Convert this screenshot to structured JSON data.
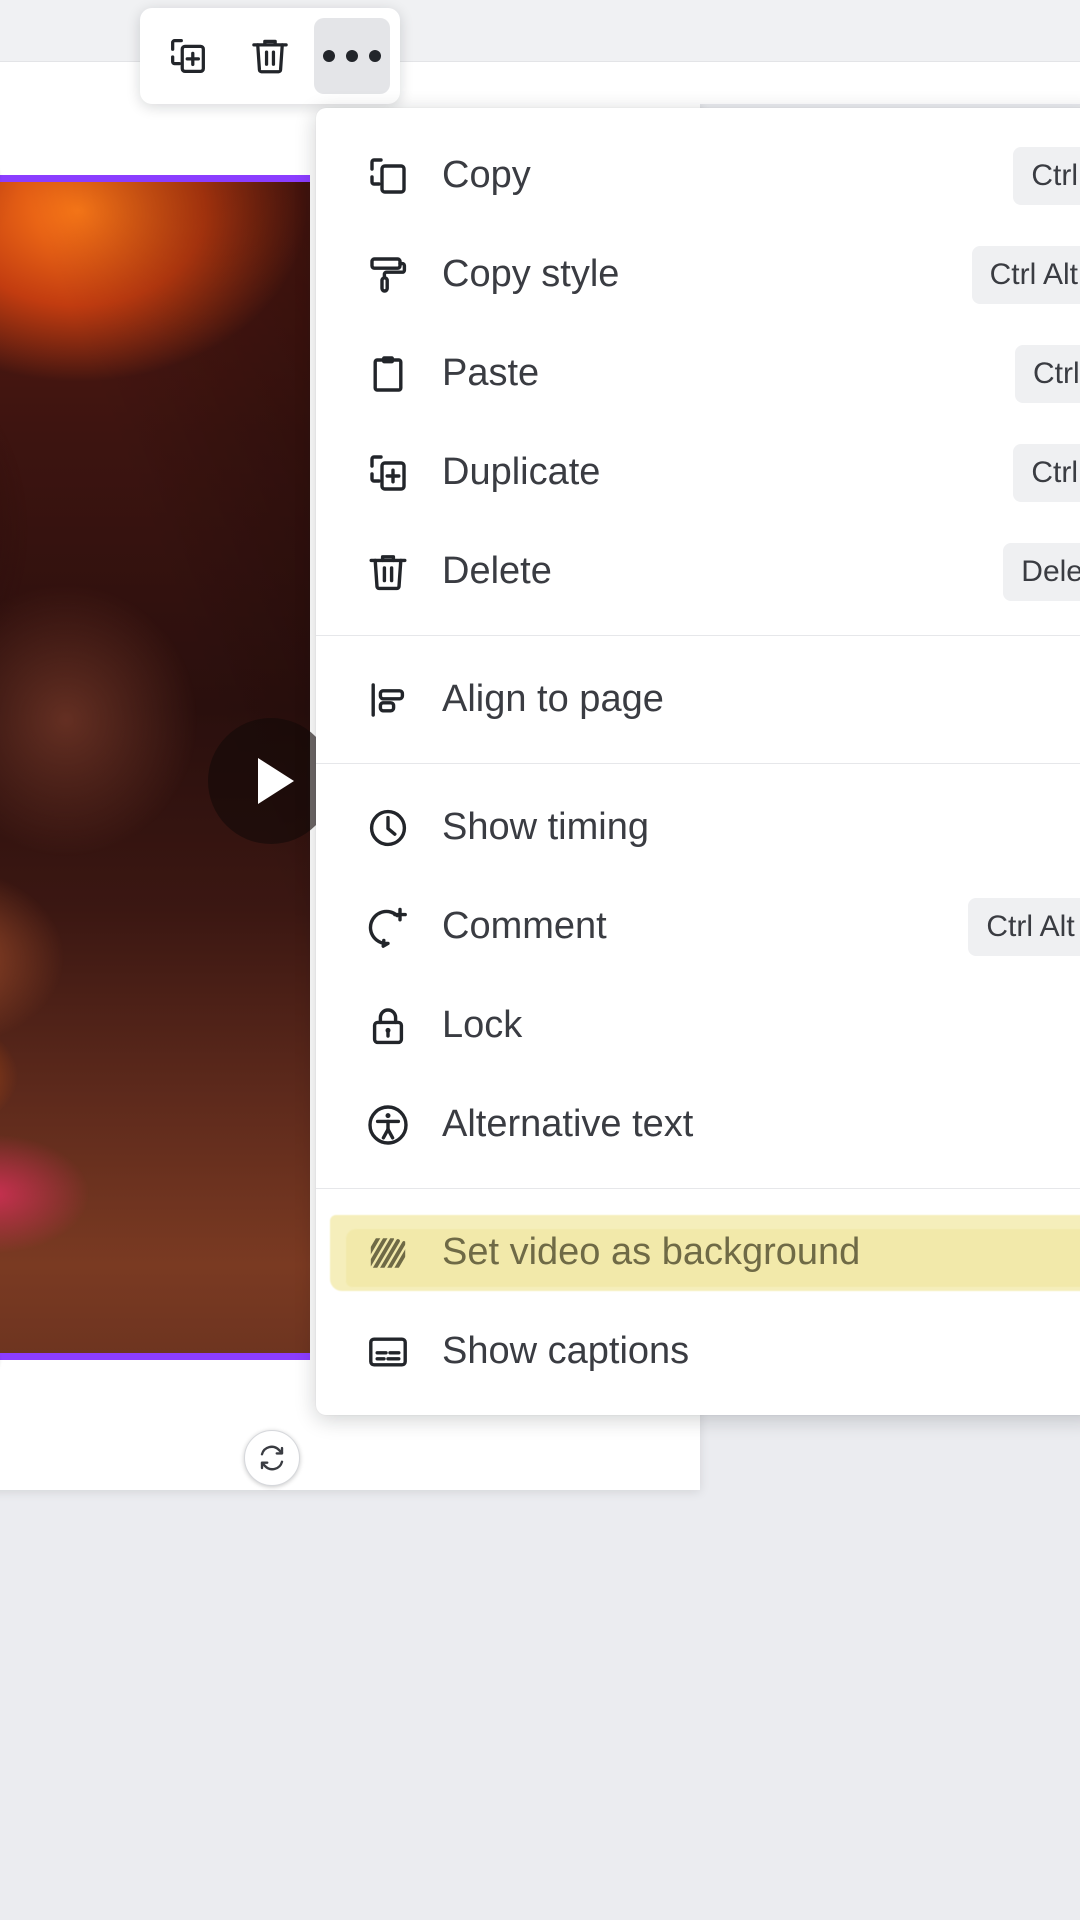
{
  "app": {
    "name": "design-editor",
    "accent_purple": "#8b3dff",
    "highlight_color": "#f5eebb",
    "menu_background": "#ffffff",
    "canvas_background": "#ebecf0"
  },
  "toolbar": {
    "name": "element-floating-toolbar",
    "buttons": [
      {
        "icon": "duplicate-icon",
        "label": "Duplicate",
        "active": false
      },
      {
        "icon": "trash-icon",
        "label": "Delete",
        "active": false
      },
      {
        "icon": "more-options-icon",
        "label": "More options",
        "active": true
      }
    ]
  },
  "context_menu": {
    "name": "element-context-menu",
    "groups": [
      {
        "items": [
          {
            "icon": "copy-icon",
            "label": "Copy",
            "shortcut": "Ctrl C"
          },
          {
            "icon": "paint-roller-icon",
            "label": "Copy style",
            "shortcut": "Ctrl Alt C"
          },
          {
            "icon": "clipboard-icon",
            "label": "Paste",
            "shortcut": "Ctrl V"
          },
          {
            "icon": "duplicate-icon",
            "label": "Duplicate",
            "shortcut": "Ctrl D"
          },
          {
            "icon": "trash-icon",
            "label": "Delete",
            "shortcut": "Delete"
          }
        ]
      },
      {
        "items": [
          {
            "icon": "align-to-page-icon",
            "label": "Align to page",
            "shortcut": ""
          }
        ]
      },
      {
        "items": [
          {
            "icon": "clock-icon",
            "label": "Show timing",
            "shortcut": ""
          },
          {
            "icon": "comment-add-icon",
            "label": "Comment",
            "shortcut": "Ctrl Alt M"
          },
          {
            "icon": "lock-icon",
            "label": "Lock",
            "shortcut": ""
          },
          {
            "icon": "accessibility-icon",
            "label": "Alternative text",
            "shortcut": ""
          }
        ]
      },
      {
        "items": [
          {
            "icon": "hatch-pattern-icon",
            "label": "Set video as background",
            "shortcut": "",
            "highlighted": true
          },
          {
            "icon": "captions-icon",
            "label": "Show captions",
            "shortcut": ""
          }
        ]
      }
    ]
  },
  "canvas": {
    "name": "design-canvas",
    "selected_element": {
      "type": "video",
      "name": "selected-video-element",
      "selection_color": "#8b3dff",
      "play_overlay": "play-icon",
      "rotate_handle": "rotate-icon"
    }
  }
}
